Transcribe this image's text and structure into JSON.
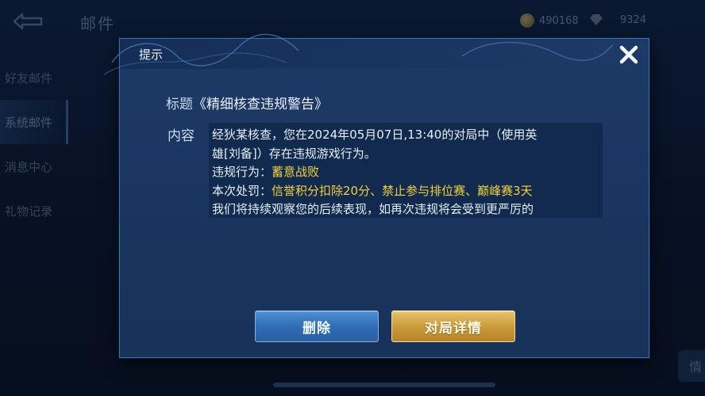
{
  "background": {
    "title": "邮件",
    "coins": "490168",
    "gems": "9324",
    "sidebar": [
      "好友邮件",
      "系统邮件",
      "消息中心",
      "礼物记录"
    ],
    "corner_button": "情"
  },
  "dialog": {
    "title": "提示",
    "subject_label": "标题",
    "subject": "《精细核查违规警告》",
    "content_label": "内容",
    "content": {
      "line1": "经狄某核查，您在2024年05月07日,13:40的对局中（使用英",
      "line2": "雄[刘备]）存在违规游戏行为。",
      "violation_label": "违规行为：",
      "violation": "蓄意战败",
      "penalty_label": "本次处罚：",
      "penalty": "信誉积分扣除20分、禁止参与排位赛、巅峰赛3天",
      "line5": "我们将持续观察您的后续表现，如再次违规将会受到更严厉的"
    },
    "delete_button": "删除",
    "detail_button": "对局详情"
  }
}
